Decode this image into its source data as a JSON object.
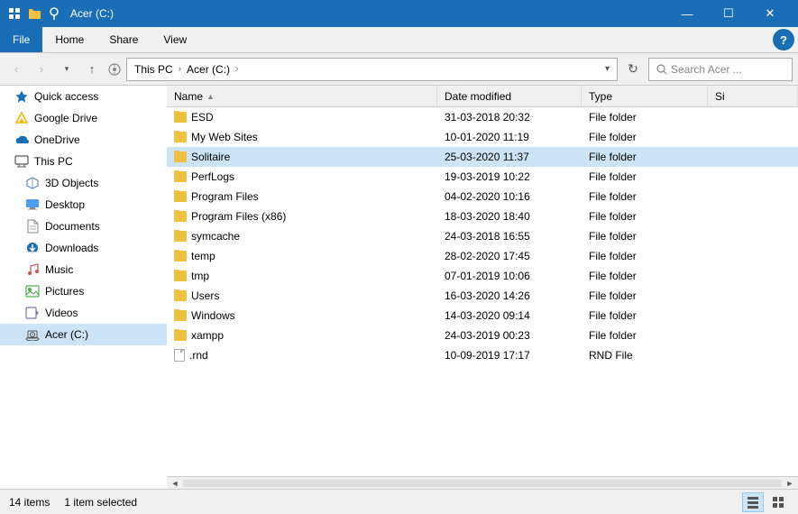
{
  "titlebar": {
    "title": "Acer (C:)",
    "minimize": "—",
    "maximize": "☐",
    "close": "✕"
  },
  "ribbon": {
    "tabs": [
      "File",
      "Home",
      "Share",
      "View"
    ],
    "active_tab": "Home",
    "help": "?"
  },
  "addressbar": {
    "back": "‹",
    "forward": "›",
    "up": "↑",
    "breadcrumb": [
      "This PC",
      "Acer (C:)"
    ],
    "refresh": "↻",
    "search_placeholder": "Search Acer ..."
  },
  "sidebar": {
    "sections": [
      {
        "label": "Quick access",
        "icon": "star",
        "items": []
      },
      {
        "label": "Google Drive",
        "icon": "drive",
        "items": []
      },
      {
        "label": "OneDrive",
        "icon": "cloud",
        "items": []
      },
      {
        "label": "This PC",
        "icon": "computer",
        "items": [
          {
            "label": "3D Objects",
            "icon": "folder-3d"
          },
          {
            "label": "Desktop",
            "icon": "folder-desktop"
          },
          {
            "label": "Documents",
            "icon": "folder-docs"
          },
          {
            "label": "Downloads",
            "icon": "folder-download"
          },
          {
            "label": "Music",
            "icon": "folder-music"
          },
          {
            "label": "Pictures",
            "icon": "folder-pictures"
          },
          {
            "label": "Videos",
            "icon": "folder-videos"
          },
          {
            "label": "Acer (C:)",
            "icon": "drive-c"
          }
        ]
      }
    ]
  },
  "filelist": {
    "columns": [
      "Name",
      "Date modified",
      "Type",
      "Size"
    ],
    "rows": [
      {
        "name": "ESD",
        "date": "31-03-2018 20:32",
        "type": "File folder",
        "size": "",
        "selected": false
      },
      {
        "name": "My Web Sites",
        "date": "10-01-2020 11:19",
        "type": "File folder",
        "size": "",
        "selected": false
      },
      {
        "name": "Solitaire",
        "date": "25-03-2020 11:37",
        "type": "File folder",
        "size": "",
        "selected": true
      },
      {
        "name": "PerfLogs",
        "date": "19-03-2019 10:22",
        "type": "File folder",
        "size": "",
        "selected": false
      },
      {
        "name": "Program Files",
        "date": "04-02-2020 10:16",
        "type": "File folder",
        "size": "",
        "selected": false
      },
      {
        "name": "Program Files (x86)",
        "date": "18-03-2020 18:40",
        "type": "File folder",
        "size": "",
        "selected": false
      },
      {
        "name": "symcache",
        "date": "24-03-2018 16:55",
        "type": "File folder",
        "size": "",
        "selected": false
      },
      {
        "name": "temp",
        "date": "28-02-2020 17:45",
        "type": "File folder",
        "size": "",
        "selected": false
      },
      {
        "name": "tmp",
        "date": "07-01-2019 10:06",
        "type": "File folder",
        "size": "",
        "selected": false
      },
      {
        "name": "Users",
        "date": "16-03-2020 14:26",
        "type": "File folder",
        "size": "",
        "selected": false
      },
      {
        "name": "Windows",
        "date": "14-03-2020 09:14",
        "type": "File folder",
        "size": "",
        "selected": false
      },
      {
        "name": "xampp",
        "date": "24-03-2019 00:23",
        "type": "File folder",
        "size": "",
        "selected": false
      },
      {
        "name": ".rnd",
        "date": "10-09-2019 17:17",
        "type": "RND File",
        "size": "",
        "selected": false
      }
    ]
  },
  "statusbar": {
    "item_count": "14 items",
    "selected": "1 item selected"
  }
}
